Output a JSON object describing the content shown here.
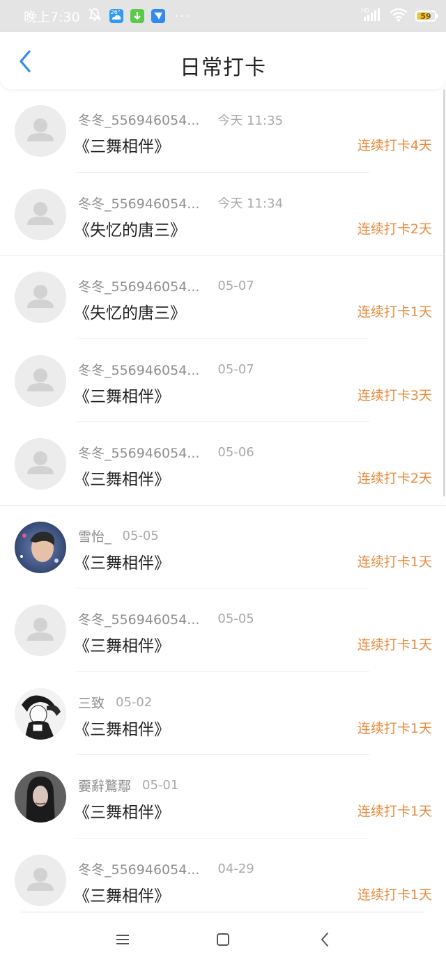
{
  "status_bar": {
    "time": "晚上7:30",
    "battery": "59",
    "icons": [
      "bell-off-icon",
      "weather-app-icon",
      "download-app-icon",
      "message-app-icon",
      "more-dots-icon",
      "signal-icon",
      "wifi-icon",
      "battery-icon"
    ],
    "weather_temp": "26°"
  },
  "header": {
    "title": "日常打卡",
    "back_icon": "chevron-left-icon",
    "accent": "#2f8bf0"
  },
  "colors": {
    "streak": "#ea8a3c",
    "meta": "#9a9a9a",
    "title": "#222222"
  },
  "records": [
    {
      "user": "冬冬_556946054...",
      "time": "今天 11:35",
      "work": "《三舞相伴》",
      "streak": "连续打卡4天",
      "avatar": "default"
    },
    {
      "user": "冬冬_556946054...",
      "time": "今天 11:34",
      "work": "《失忆的唐三》",
      "streak": "连续打卡2天",
      "avatar": "default"
    },
    {
      "user": "冬冬_556946054...",
      "time": "05-07",
      "work": "《失忆的唐三》",
      "streak": "连续打卡1天",
      "avatar": "default"
    },
    {
      "user": "冬冬_556946054...",
      "time": "05-07",
      "work": "《三舞相伴》",
      "streak": "连续打卡3天",
      "avatar": "default"
    },
    {
      "user": "冬冬_556946054...",
      "time": "05-06",
      "work": "《三舞相伴》",
      "streak": "连续打卡2天",
      "avatar": "default"
    },
    {
      "user": "雪怡_",
      "time": "05-05",
      "work": "《三舞相伴》",
      "streak": "连续打卡1天",
      "avatar": "photo-boy"
    },
    {
      "user": "冬冬_556946054...",
      "time": "05-05",
      "work": "《三舞相伴》",
      "streak": "连续打卡1天",
      "avatar": "default"
    },
    {
      "user": "三致",
      "time": "05-02",
      "work": "《三舞相伴》",
      "streak": "连续打卡1天",
      "avatar": "photo-anime"
    },
    {
      "user": "嫑辭鶩鄢",
      "time": "05-01",
      "work": "《三舞相伴》",
      "streak": "连续打卡1天",
      "avatar": "photo-girl"
    },
    {
      "user": "冬冬_556946054...",
      "time": "04-29",
      "work": "《三舞相伴》",
      "streak": "连续打卡1天",
      "avatar": "default"
    }
  ],
  "system_nav": {
    "menu_icon": "menu-icon",
    "home_icon": "home-square-icon",
    "back_icon": "back-triangle-icon"
  }
}
